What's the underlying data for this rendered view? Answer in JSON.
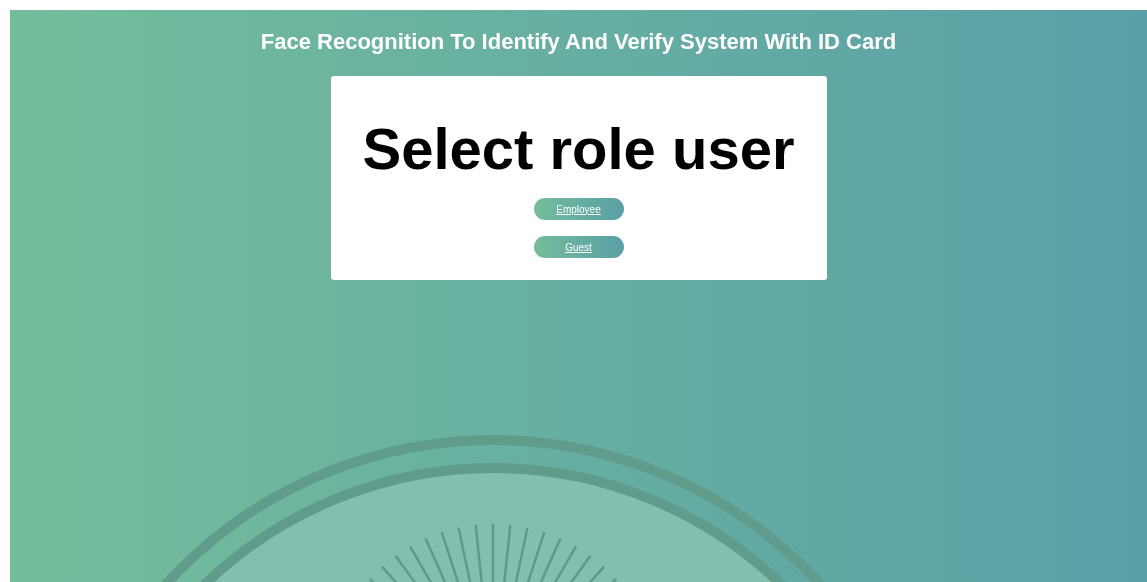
{
  "header": {
    "title": "Face Recognition To Identify And Verify System With ID Card"
  },
  "card": {
    "heading": "Select role user",
    "buttons": [
      {
        "label": "Employee"
      },
      {
        "label": "Guest"
      }
    ]
  }
}
